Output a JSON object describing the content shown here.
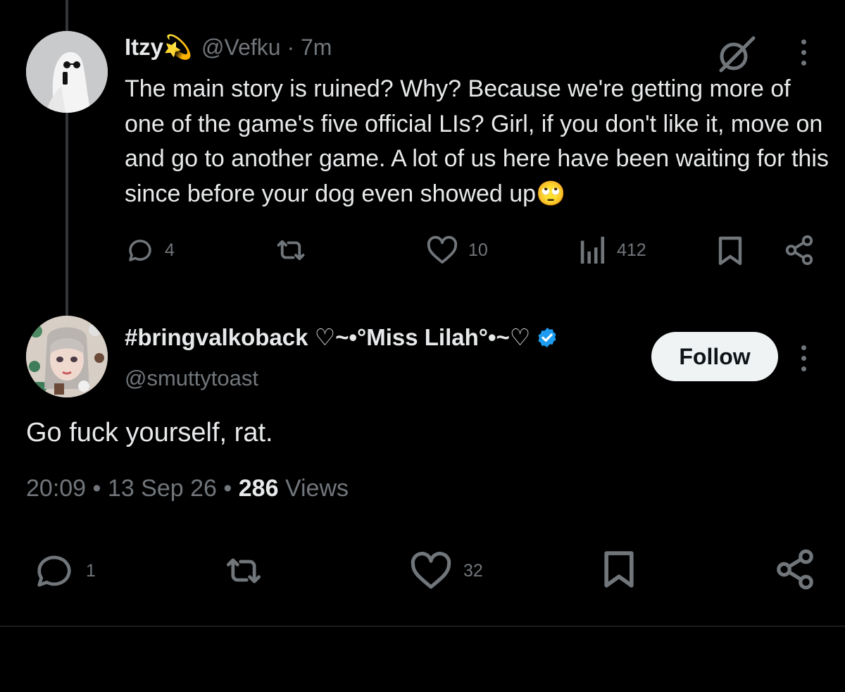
{
  "reply_tweet": {
    "display_name": "Itzy",
    "display_name_emoji": "💫",
    "handle": "@Vefku",
    "separator": "·",
    "time_ago": "7m",
    "text": "The main story is ruined? Why? Because we're getting more of one of the game's five official LIs? Girl, if you don't like it, move on and go to another game. A lot of us here have been waiting for this since before your dog even showed up",
    "text_emoji": "🙄",
    "icons": {
      "grok": "grok-slash-icon",
      "more": "more-vertical-icon"
    },
    "actions": {
      "reply_count": "4",
      "retweet_count": "",
      "like_count": "10",
      "view_count": "412"
    }
  },
  "main_tweet": {
    "display_name": "#bringvalkoback ♡~•°Miss Lilah°•~♡",
    "verified": true,
    "handle": "@smuttytoast",
    "follow_label": "Follow",
    "text": "Go fuck yourself, rat.",
    "time": "20:09",
    "date": "13 Sep 26",
    "separator": "•",
    "views_count": "286",
    "views_label": "Views",
    "actions": {
      "reply_count": "1",
      "retweet_count": "",
      "like_count": "32"
    }
  },
  "colors": {
    "background": "#000000",
    "text_primary": "#e7e9ea",
    "text_secondary": "#71767b",
    "verified_blue": "#1d9bf0",
    "follow_button_bg": "#eff3f4"
  }
}
